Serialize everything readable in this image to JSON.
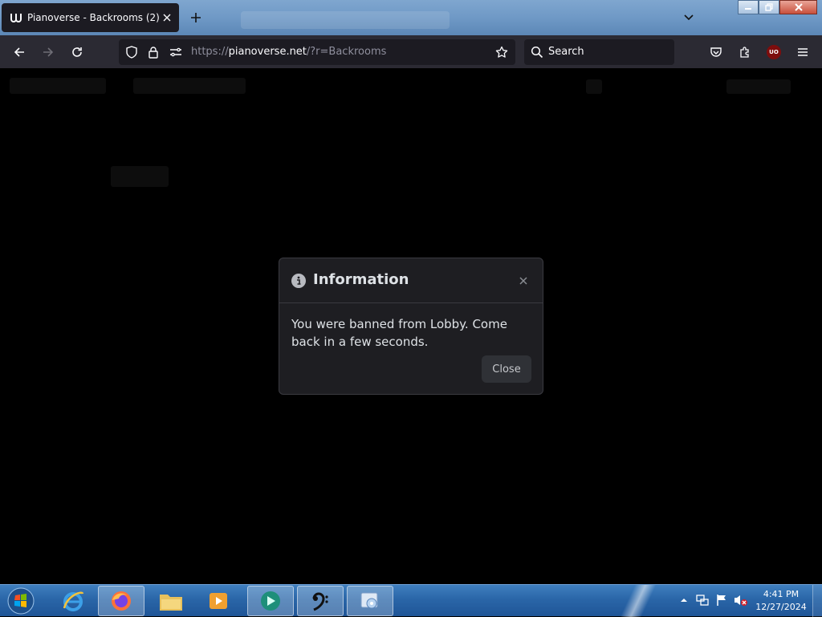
{
  "browser": {
    "tab": {
      "title": "Pianoverse - Backrooms (2)"
    },
    "url": {
      "prefix": "https://",
      "host": "pianoverse.net",
      "path": "/?r=Backrooms"
    },
    "search_placeholder": "Search",
    "extension_badge": "UO"
  },
  "modal": {
    "title": "Information",
    "message": "You were banned from Lobby. Come back in a few seconds.",
    "close_label": "Close"
  },
  "taskbar": {
    "clock_time": "4:41 PM",
    "clock_date": "12/27/2024",
    "apps": [
      "internet-explorer",
      "firefox",
      "file-explorer",
      "media-player",
      "app-green-play",
      "bass-clef-app",
      "media-center"
    ]
  },
  "colors": {
    "modal_bg": "#1e1e22",
    "nav_bg": "#2b2a33",
    "taskbar_bg": "#2a66a8"
  }
}
